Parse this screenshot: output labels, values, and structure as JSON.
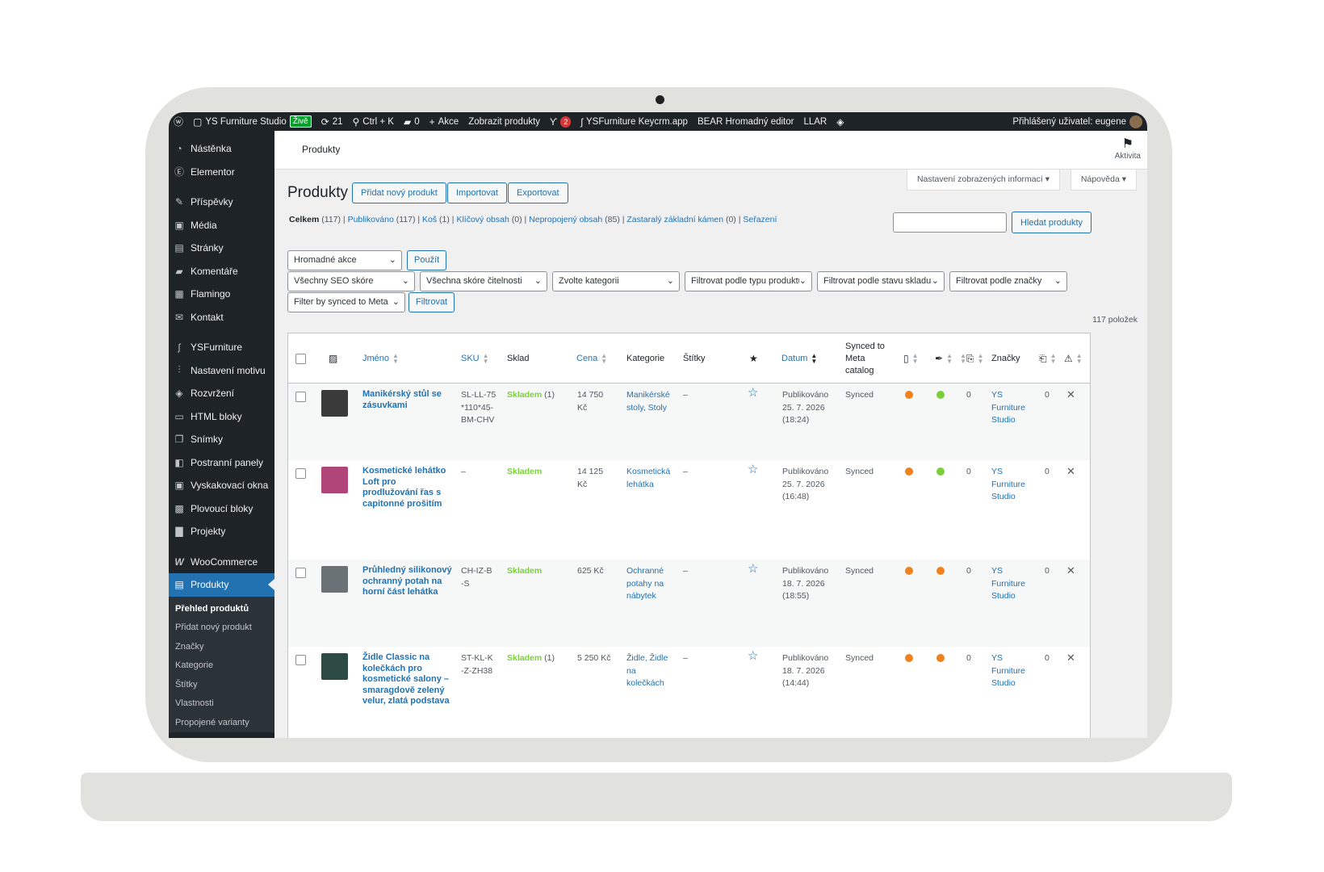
{
  "adminbar": {
    "wp_logo": "wordpress-icon",
    "site_name": "YS Furniture Studio",
    "live": "Živě",
    "updates": "21",
    "search": "Ctrl + K",
    "comments": "0",
    "new": "Akce",
    "view_products": "Zobrazit produkty",
    "yoast_count": "2",
    "keycrm": "YSFurniture Keycrm.app",
    "bear": "BEAR Hromadný editor",
    "llar": "LLAR",
    "user": "Přihlášený uživatel: eugene"
  },
  "sidebar": {
    "items": [
      {
        "label": "Nástěnka",
        "icon": "dashboard-icon"
      },
      {
        "label": "Elementor",
        "icon": "elementor-icon"
      },
      {
        "label": "Příspěvky",
        "icon": "pin-icon"
      },
      {
        "label": "Média",
        "icon": "media-icon"
      },
      {
        "label": "Stránky",
        "icon": "pages-icon"
      },
      {
        "label": "Komentáře",
        "icon": "comments-icon"
      },
      {
        "label": "Flamingo",
        "icon": "flamingo-icon"
      },
      {
        "label": "Kontakt",
        "icon": "mail-icon"
      },
      {
        "label": "YSFurniture",
        "icon": "ysf-logo-icon"
      },
      {
        "label": "Nastavení motivu",
        "icon": "sliders-icon"
      },
      {
        "label": "Rozvržení",
        "icon": "layers-icon"
      },
      {
        "label": "HTML bloky",
        "icon": "html-icon"
      },
      {
        "label": "Snímky",
        "icon": "slides-icon"
      },
      {
        "label": "Postranní panely",
        "icon": "sidebar-icon"
      },
      {
        "label": "Vyskakovací okna",
        "icon": "popup-icon"
      },
      {
        "label": "Plovoucí bloky",
        "icon": "floating-icon"
      },
      {
        "label": "Projekty",
        "icon": "briefcase-icon"
      },
      {
        "label": "WooCommerce",
        "icon": "woocommerce-icon"
      },
      {
        "label": "Produkty",
        "icon": "archive-icon"
      }
    ],
    "submenu": [
      "Přehled produktů",
      "Přidat nový produkt",
      "Značky",
      "Kategorie",
      "Štítky",
      "Vlastnosti",
      "Propojené varianty"
    ]
  },
  "header": {
    "breadcrumb": "Produkty",
    "activity": "Aktivita",
    "screen_options": "Nastavení zobrazených informací",
    "help": "Nápověda"
  },
  "page": {
    "title": "Produkty",
    "add_new": "Přidat nový produkt",
    "import": "Importovat",
    "export": "Exportovat",
    "search_button": "Hledat produkty",
    "items_count": "117 položek"
  },
  "views": {
    "all": "Celkem",
    "all_count": "(117)",
    "published": "Publikováno",
    "published_count": "(117)",
    "trash": "Koš",
    "trash_count": "(1)",
    "cornerstone": "Klíčový obsah",
    "cornerstone_count": "(0)",
    "orphaned": "Nepropojený obsah",
    "orphaned_count": "(85)",
    "stale": "Zastaralý základní kámen",
    "stale_count": "(0)",
    "sorting": "Seřazení"
  },
  "filters": {
    "bulk": "Hromadné akce",
    "apply": "Použít",
    "seo": "Všechny SEO skóre",
    "readability": "Všechna skóre čitelnosti",
    "category": "Zvolte kategorii",
    "type": "Filtrovat podle typu produktu",
    "stock": "Filtrovat podle stavu skladu",
    "brand": "Filtrovat podle značky",
    "meta": "Filter by synced to Meta",
    "filter": "Filtrovat"
  },
  "table": {
    "headers": {
      "name": "Jméno",
      "sku": "SKU",
      "stock": "Sklad",
      "price": "Cena",
      "categories": "Kategorie",
      "tags": "Štítky",
      "date": "Datum",
      "synced": "Synced to Meta catalog",
      "brands": "Značky"
    },
    "rows": [
      {
        "name": "Manikérský stůl se zásuvkami",
        "sku": "SL-LL-75*110*45-BM-CHV",
        "stock": "Skladem",
        "stock_qty": "(1)",
        "price": "14 750 Kč",
        "categories": "Manikérské stoly, Stoly",
        "tags": "–",
        "status": "Publikováno",
        "date": "25. 7. 2026",
        "time": "(18:24)",
        "synced": "Synced",
        "seo_color": "#f0821e",
        "read_color": "#7ad03a",
        "links": "0",
        "brand": "YS Furniture Studio",
        "count2": "0",
        "thumb_color": "#3a3a3a"
      },
      {
        "name": "Kosmetické lehátko Loft pro prodlužování řas s capitonné prošitím",
        "sku": "–",
        "stock": "Skladem",
        "stock_qty": "",
        "price": "14 125 Kč",
        "categories": "Kosmetická lehátka",
        "tags": "–",
        "status": "Publikováno",
        "date": "25. 7. 2026",
        "time": "(16:48)",
        "synced": "Synced",
        "seo_color": "#f0821e",
        "read_color": "#7ad03a",
        "links": "0",
        "brand": "YS Furniture Studio",
        "count2": "0",
        "thumb_color": "#b0457a"
      },
      {
        "name": "Průhledný silikonový ochranný potah na horní část lehátka",
        "sku": "CH-IZ-B-S",
        "stock": "Skladem",
        "stock_qty": "",
        "price": "625 Kč",
        "categories": "Ochranné potahy na nábytek",
        "tags": "–",
        "status": "Publikováno",
        "date": "18. 7. 2026",
        "time": "(18:55)",
        "synced": "Synced",
        "seo_color": "#f0821e",
        "read_color": "#f0821e",
        "links": "0",
        "brand": "YS Furniture Studio",
        "count2": "0",
        "thumb_color": "#6b7275"
      },
      {
        "name": "Židle Classic na kolečkách pro kosmetické salony – smaragdově zelený velur, zlatá podstava",
        "sku": "ST-KL-K-Z-ZH38",
        "stock": "Skladem",
        "stock_qty": "(1)",
        "price": "5 250 Kč",
        "categories": "Židle, Židle na kolečkách",
        "tags": "–",
        "status": "Publikováno",
        "date": "18. 7. 2026",
        "time": "(14:44)",
        "synced": "Synced",
        "seo_color": "#f0821e",
        "read_color": "#f0821e",
        "links": "0",
        "brand": "YS Furniture Studio",
        "count2": "0",
        "thumb_color": "#2d4a44"
      }
    ]
  }
}
